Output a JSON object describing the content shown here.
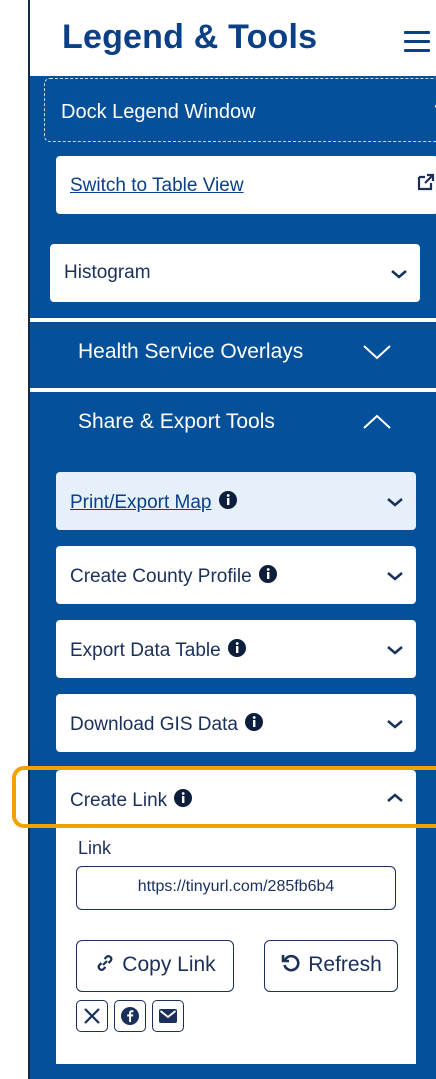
{
  "header": {
    "title": "Legend & Tools"
  },
  "dock": {
    "label": "Dock Legend Window"
  },
  "switch_view": {
    "label": "Switch to Table View"
  },
  "histogram": {
    "label": "Histogram"
  },
  "sections": {
    "health": {
      "label": "Health Service Overlays"
    },
    "share": {
      "label": "Share & Export Tools"
    }
  },
  "tools": [
    {
      "label": "Print/Export Map"
    },
    {
      "label": "Create County Profile"
    },
    {
      "label": "Export Data Table"
    },
    {
      "label": "Download GIS Data"
    },
    {
      "label": "Create Link"
    }
  ],
  "create_link": {
    "field_label": "Link",
    "url": "https://tinyurl.com/285fb6b4",
    "copy_label": "Copy Link",
    "refresh_label": "Refresh"
  },
  "colors": {
    "brand": "#04509a",
    "highlight": "#f2a200"
  }
}
